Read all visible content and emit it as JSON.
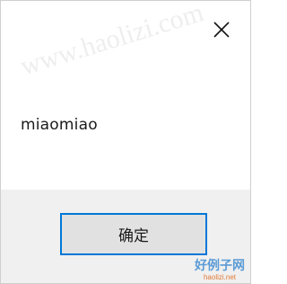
{
  "dialog": {
    "message": "miaomiao",
    "ok_label": "确定",
    "close_icon": "close-icon"
  },
  "watermark": {
    "text": "www.haolizi.com"
  },
  "logo": {
    "text_cn": "好例子网",
    "text_en": "haolizi.net"
  },
  "colors": {
    "focus_border": "#0078d7",
    "footer_bg": "#f0f0f0",
    "button_bg": "#e1e1e1"
  }
}
